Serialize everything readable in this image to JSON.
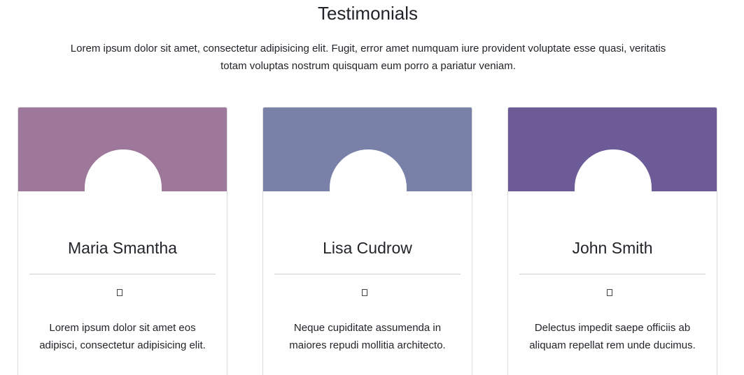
{
  "section": {
    "title": "Testimonials",
    "lead": "Lorem ipsum dolor sit amet, consectetur adipisicing elit. Fugit, error amet numquam iure provident voluptate esse quasi, veritatis totam voluptas nostrum quisquam eum porro a pariatur veniam."
  },
  "testimonials": [
    {
      "name": "Maria Smantha",
      "text": "Lorem ipsum dolor sit amet eos adipisci, consectetur adipisicing elit.",
      "header_color": "#9d789b",
      "quote_icon": "quote-left-icon"
    },
    {
      "name": "Lisa Cudrow",
      "text": "Neque cupiditate assumenda in maiores repudi mollitia architecto.",
      "header_color": "#7a81a8",
      "quote_icon": "quote-left-icon"
    },
    {
      "name": "John Smith",
      "text": "Delectus impedit saepe officiis ab aliquam repellat rem unde ducimus.",
      "header_color": "#6d5b97",
      "quote_icon": "quote-left-icon"
    }
  ]
}
